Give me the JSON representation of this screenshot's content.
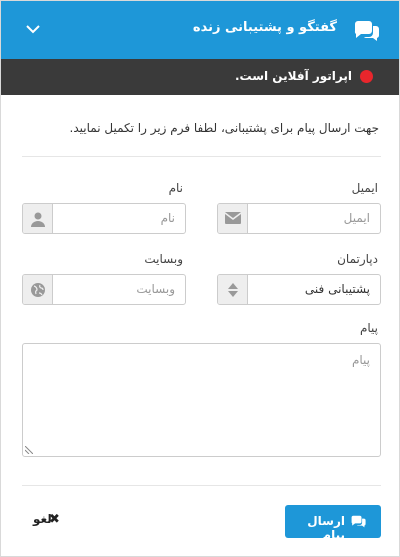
{
  "header": {
    "title": "گفتگو و پشتیبانی زنده"
  },
  "status": {
    "text": "اپراتور آفلاین است."
  },
  "intro": "جهت ارسال پیام برای پشتیبانی، لطفا فرم زیر را تکمیل نمایید.",
  "fields": {
    "email": {
      "label": "ایمیل",
      "placeholder": "ایمیل",
      "icon": "envelope-icon"
    },
    "name": {
      "label": "نام",
      "placeholder": "نام",
      "icon": "user-icon"
    },
    "department": {
      "label": "دپارتمان",
      "value": "پشتیبانی فنی",
      "icon": "sort-icon"
    },
    "website": {
      "label": "وبسایت",
      "placeholder": "وبسایت",
      "icon": "globe-icon"
    },
    "message": {
      "label": "پیام",
      "placeholder": "پیام"
    }
  },
  "actions": {
    "send": "ارسال پیام",
    "cancel": "لغو"
  },
  "colors": {
    "accent": "#1e97d8",
    "status_bar": "#3a3a3a",
    "offline_dot": "#e8262c"
  }
}
